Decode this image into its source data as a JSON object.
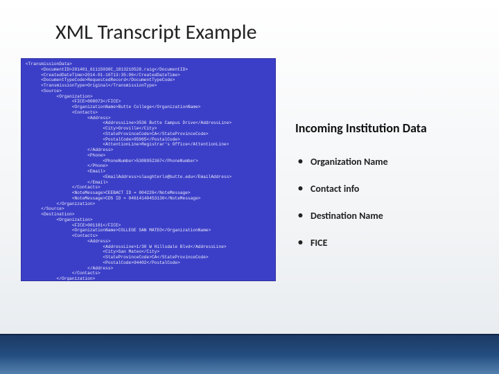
{
  "title": "XML Transcript Example",
  "right": {
    "heading": "Incoming Institution Data",
    "bullets": [
      "Organization Name",
      "Contact info",
      "Destination Name",
      "FICE"
    ]
  },
  "xml_text": "<TransmissionData>\n      <DocumentID>201401_61115030C_1813210528.raig</DocumentID>\n      <CreatedDateTime>2014-01-16T13:35:06</CreatedDateTime>\n      <DocumentTypeCode>RequestedRecord</DocumentTypeCode>\n      <TransmissionType>Original</TransmissionType>\n      <Source>\n            <Organization>\n                  <FICE>008073</FICE>\n                  <OrganizationName>Butte College</OrganizationName>\n                  <Contacts>\n                        <Address>\n                              <AddressLine>3536 Butte Campus Drive</AddressLine>\n                              <City>Oroville</City>\n                              <StateProvinceCode>CA</StateProvinceCode>\n                              <PostalCode>95965</PostalCode>\n                              <AttentionLine>Registrar's Office</AttentionLine>\n                        </Address>\n                        <Phone>\n                              <PhoneNumber>5308952367</PhoneNumber>\n                        </Phone>\n                        <Email>\n                              <EmailAddress>slaughterlo@butte.edu</EmailAddress>\n                        </Email>\n                  </Contacts>\n                  <NoteMessage>CEEBACT ID = 004226</NoteMessage>\n                  <NoteMessage>CDS ID = 04614140453130</NoteMessage>\n            </Organization>\n      </Source>\n      <Destination>\n            <Organization>\n                  <FICE>001181</FICE>\n                  <OrganizationName>COLLEGE SAN MATEO</OrganizationName>\n                  <Contacts>\n                        <Address>\n                              <AddressLine>1/30 W Hillsdale Blvd</AddressLine>\n                              <City>San Mateo</City>\n                              <StateProvinceCode>CA</StateProvinceCode>\n                              <PostalCode>94402</PostalCode>\n                        </Address>\n                  </Contacts>\n            </Organization>\n      </Destination>\n      <DocumentProcessCode>xml</DocumentProcessCode>"
}
